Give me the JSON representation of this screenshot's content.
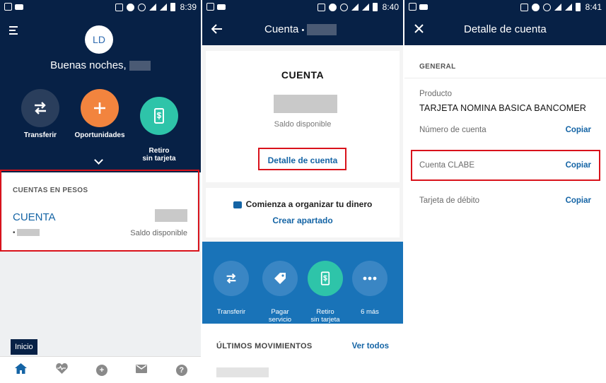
{
  "screen1": {
    "status_time": "8:39",
    "avatar_initials": "LD",
    "greeting": "Buenas noches,",
    "actions": [
      {
        "label": "Transferir",
        "icon": "transfer-icon"
      },
      {
        "label": "Oportunidades",
        "icon": "plus-icon"
      },
      {
        "label": "Retiro\nsin tarjeta",
        "icon": "cash-phone-icon"
      }
    ],
    "section_header": "CUENTAS EN PESOS",
    "account_name": "CUENTA",
    "account_number_prefix": "•",
    "balance_label": "Saldo disponible",
    "inicio_label": "Inicio",
    "bottom_nav": [
      "home-icon",
      "heart-pulse-icon",
      "plus-circle-icon",
      "mail-icon",
      "help-icon"
    ]
  },
  "screen2": {
    "status_time": "8:40",
    "title": "Cuenta",
    "title_sep": "•",
    "card_title": "CUENTA",
    "balance_label": "Saldo disponible",
    "detail_link": "Detalle de cuenta",
    "organize_text": "Comienza a organizar tu dinero",
    "create_link": "Crear apartado",
    "quick_actions": [
      {
        "label": "Transferir",
        "icon": "transfer-icon"
      },
      {
        "label": "Pagar\nservicio",
        "icon": "tag-icon"
      },
      {
        "label": "Retiro\nsin tarjeta",
        "icon": "cash-phone-icon"
      },
      {
        "label": "6 más",
        "icon": "more-icon"
      }
    ],
    "movements_title": "ÚLTIMOS MOVIMIENTOS",
    "see_all": "Ver todos"
  },
  "screen3": {
    "status_time": "8:41",
    "title": "Detalle de cuenta",
    "section": "GENERAL",
    "product_label": "Producto",
    "product_value": "TARJETA NOMINA BASICA BANCOMER",
    "account_number_label": "Número de cuenta",
    "clabe_label": "Cuenta CLABE",
    "debit_label": "Tarjeta de débito",
    "copy_label": "Copiar"
  },
  "colors": {
    "navy": "#072146",
    "link_blue": "#1464a5",
    "band_blue": "#1973b8",
    "orange": "#f2843e",
    "teal": "#2ec4a9",
    "highlight_red": "#d9121b"
  }
}
